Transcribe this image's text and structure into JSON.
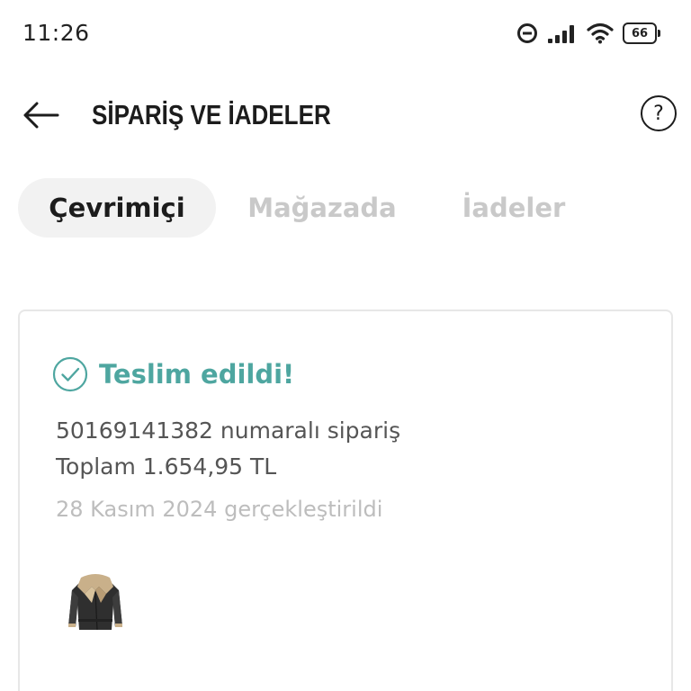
{
  "status_bar": {
    "time": "11:26",
    "battery": "66",
    "icons": [
      "do-not-disturb-icon",
      "signal-icon",
      "wifi-icon",
      "battery-icon"
    ]
  },
  "header": {
    "title": "SİPARİŞ VE İADELER",
    "back_icon": "arrow-left-icon",
    "help_label": "?"
  },
  "tabs": [
    {
      "label": "Çevrimiçi",
      "active": true
    },
    {
      "label": "Mağazada",
      "active": false
    },
    {
      "label": "İadeler",
      "active": false
    }
  ],
  "order": {
    "status": "Teslim edildi!",
    "number_text": "50169141382 numaralı sipariş",
    "total_text": "Toplam 1.654,95 TL",
    "date_text": "28 Kasım 2024 gerçekleştirildi",
    "status_color": "#4ea6a0",
    "item_icon": "jacket-thumbnail"
  }
}
